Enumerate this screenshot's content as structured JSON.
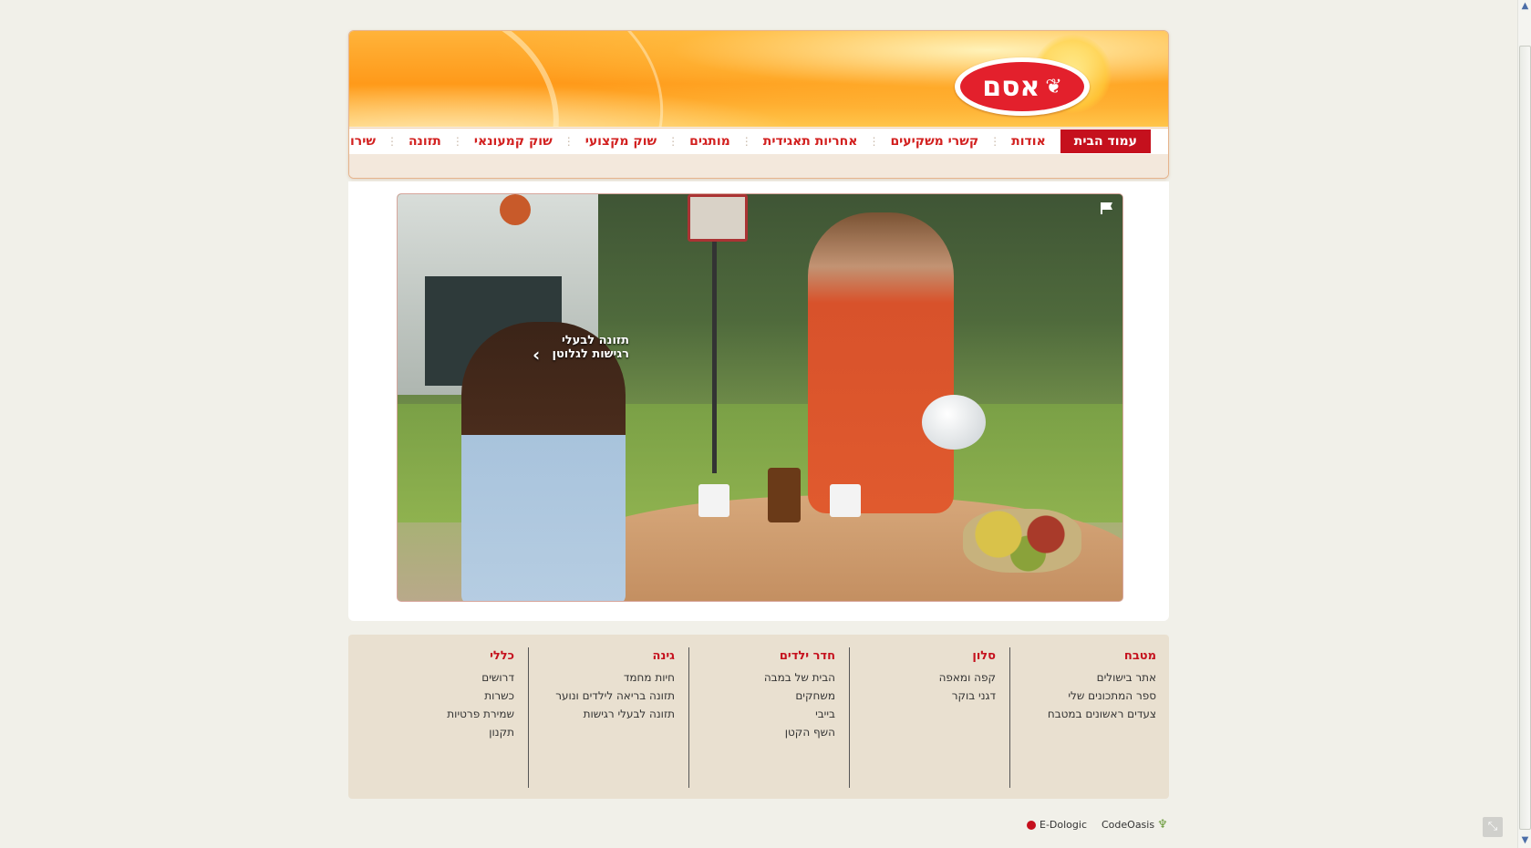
{
  "header": {
    "logo_text": "אסם",
    "nav": [
      {
        "label": "עמוד הבית",
        "active": true
      },
      {
        "label": "אודות"
      },
      {
        "label": "קשרי משקיעים"
      },
      {
        "label": "אחריות תאגידית"
      },
      {
        "label": "מותגים"
      },
      {
        "label": "שוק מקצועי"
      },
      {
        "label": "שוק קמעונאי"
      },
      {
        "label": "תזונה"
      },
      {
        "label": "שירות צרכנים"
      }
    ]
  },
  "video": {
    "caption_line1": "תזונה לבעלי",
    "caption_line2": "רגישות לגלוטן",
    "arrow": "‹",
    "sound_icon": "speaker-icon"
  },
  "footer_menu": [
    {
      "title": "מטבח",
      "links": [
        "אתר בישולים",
        "ספר המתכונים שלי",
        "צעדים ראשונים במטבח"
      ]
    },
    {
      "title": "סלון",
      "links": [
        "קפה ומאפה",
        "דגני בוקר"
      ]
    },
    {
      "title": "חדר ילדים",
      "links": [
        "הבית של במבה",
        "משחקים",
        "בייבי",
        "השף הקטן"
      ]
    },
    {
      "title": "גינה",
      "links": [
        "חיות מחמד",
        "תזונה בריאה לילדים ונוער",
        "תזונה לבעלי רגישות"
      ]
    },
    {
      "title": "כללי",
      "links": [
        "דרושים",
        "כשרות",
        "שמירת פרטיות",
        "תקנון"
      ]
    }
  ],
  "credits": {
    "edologic": "E-Dologic",
    "codeoasis": "CodeOasis"
  },
  "colors": {
    "brand_red": "#c5101d",
    "orange": "#ff9a1a",
    "footer_bg": "#e9e0d0"
  }
}
